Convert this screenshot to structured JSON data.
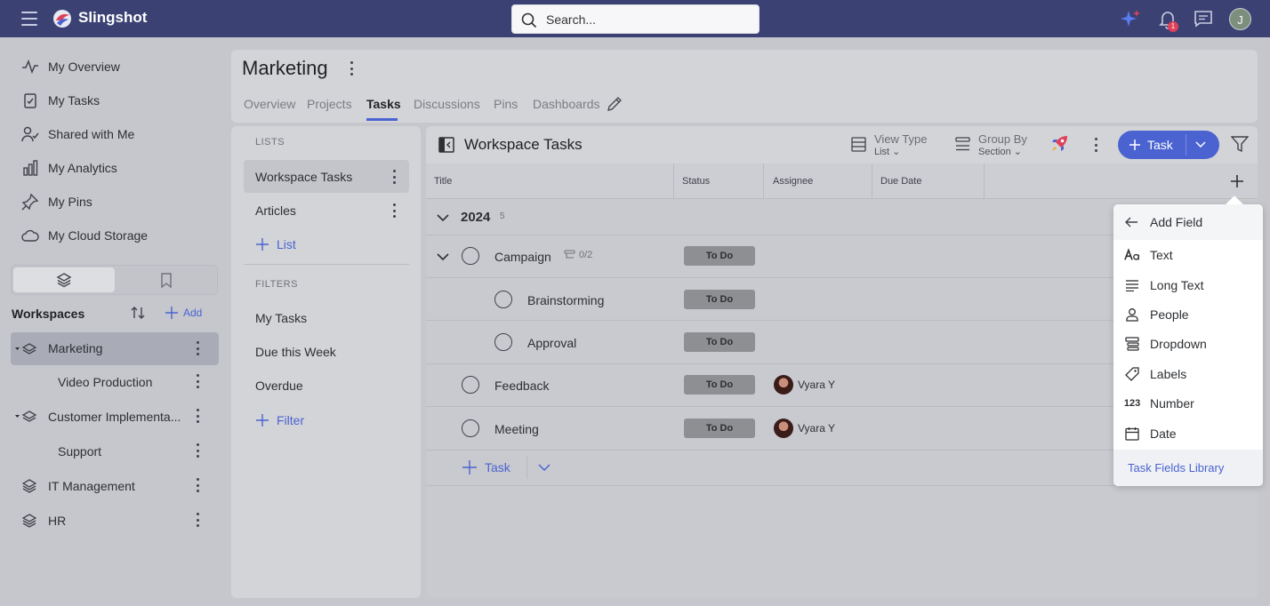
{
  "app": {
    "name": "Slingshot",
    "user_initial": "J",
    "notification_count": "1"
  },
  "search": {
    "placeholder": "Search..."
  },
  "nav": [
    {
      "label": "My Overview"
    },
    {
      "label": "My Tasks"
    },
    {
      "label": "Shared with Me"
    },
    {
      "label": "My Analytics"
    },
    {
      "label": "My Pins"
    },
    {
      "label": "My Cloud Storage"
    }
  ],
  "workspaces": {
    "title": "Workspaces",
    "add_label": "Add",
    "items": [
      {
        "label": "Marketing"
      },
      {
        "label": "Video Production"
      },
      {
        "label": "Customer Implementa..."
      },
      {
        "label": "Support"
      },
      {
        "label": "IT Management"
      },
      {
        "label": "HR"
      }
    ]
  },
  "header": {
    "title": "Marketing",
    "tabs": [
      "Overview",
      "Projects",
      "Tasks",
      "Discussions",
      "Pins",
      "Dashboards"
    ],
    "active_tab": "Tasks"
  },
  "lists_panel": {
    "lists_label": "LISTS",
    "lists": [
      "Workspace Tasks",
      "Articles"
    ],
    "add_list_label": "List",
    "filters_label": "FILTERS",
    "filters": [
      "My Tasks",
      "Due this Week",
      "Overdue"
    ],
    "add_filter_label": "Filter"
  },
  "main": {
    "title": "Workspace Tasks",
    "view_type": {
      "label": "View Type",
      "value": "List"
    },
    "group_by": {
      "label": "Group By",
      "value": "Section"
    },
    "task_button": "Task",
    "columns": [
      "Title",
      "Status",
      "Assignee",
      "Due Date"
    ],
    "group": {
      "label": "2024",
      "count": "5"
    },
    "tasks": [
      {
        "name": "Campaign",
        "status": "To Do",
        "subtasks": "0/2",
        "assignee": ""
      },
      {
        "name": "Brainstorming",
        "status": "To Do",
        "assignee": ""
      },
      {
        "name": "Approval",
        "status": "To Do",
        "assignee": ""
      },
      {
        "name": "Feedback",
        "status": "To Do",
        "assignee": "Vyara Y"
      },
      {
        "name": "Meeting",
        "status": "To Do",
        "assignee": "Vyara Y"
      }
    ],
    "add_task_label": "Task"
  },
  "add_field": {
    "title": "Add Field",
    "options": [
      "Text",
      "Long Text",
      "People",
      "Dropdown",
      "Labels",
      "Number",
      "Date"
    ],
    "number_icon_text": "123",
    "footer": "Task Fields Library"
  },
  "colors": {
    "topbar": "#3b4273",
    "accent": "#4a63d1",
    "status_todo": "#8d8f93"
  }
}
